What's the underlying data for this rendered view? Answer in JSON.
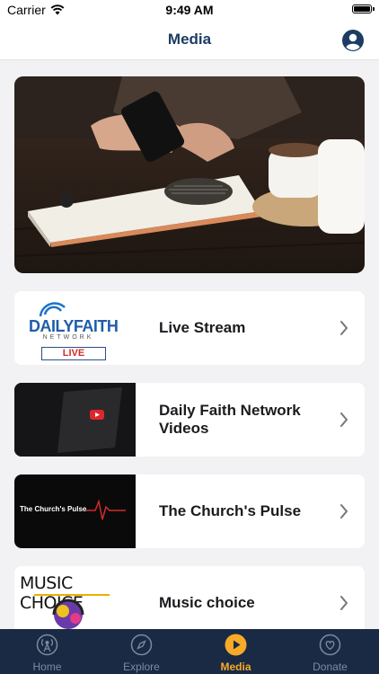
{
  "status_bar": {
    "carrier": "Carrier",
    "time": "9:49 AM"
  },
  "nav": {
    "title": "Media"
  },
  "cards": [
    {
      "label": "Live Stream",
      "thumb_logo_main": "DAILYFAITH",
      "thumb_logo_sub": "NETWORK",
      "thumb_badge": "LIVE"
    },
    {
      "label": "Daily Faith Network Videos"
    },
    {
      "label": "The Church's Pulse",
      "thumb_text": "The Church's Pulse"
    },
    {
      "label": "Music choice",
      "thumb_text": "MUSIC CHOICE"
    }
  ],
  "tabbar": {
    "items": [
      {
        "label": "Home",
        "icon": "radio-tower-icon"
      },
      {
        "label": "Explore",
        "icon": "compass-icon"
      },
      {
        "label": "Media",
        "icon": "play-icon"
      },
      {
        "label": "Donate",
        "icon": "heart-icon"
      }
    ],
    "active": "Media",
    "active_color": "#f7a928"
  },
  "colors": {
    "nav_title": "#1c3c63",
    "tabbar_bg": "#1a2a44"
  }
}
